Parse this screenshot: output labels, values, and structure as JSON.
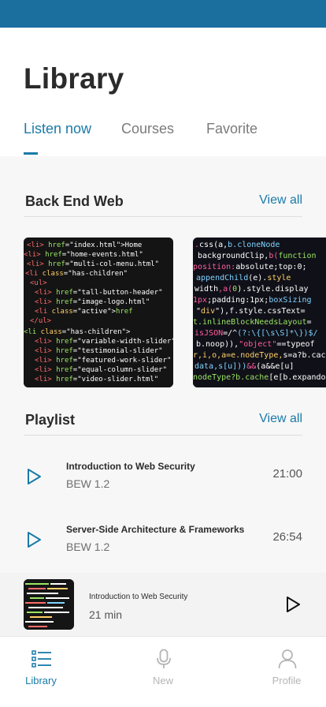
{
  "header": {
    "title": "Library",
    "tabs": [
      {
        "label": "Listen now",
        "active": true
      },
      {
        "label": "Courses",
        "active": false
      },
      {
        "label": "Favorite",
        "active": false
      }
    ]
  },
  "sections": {
    "backend": {
      "title": "Back End Web",
      "view_all": "View all"
    },
    "playlist": {
      "title": "Playlist",
      "view_all": "View all",
      "items": [
        {
          "title": "Introduction to Web Security",
          "subtitle": "BEW 1.2",
          "duration": "21:00"
        },
        {
          "title": "Server-Side Architecture & Frameworks",
          "subtitle": "BEW 1.2",
          "duration": "26:54"
        }
      ]
    }
  },
  "mini_player": {
    "title": "Introduction to Web Security",
    "subtitle": "21 min"
  },
  "tabbar": {
    "items": [
      {
        "label": "Library",
        "icon": "list-icon",
        "active": true
      },
      {
        "label": "New",
        "icon": "microphone-icon",
        "active": false
      },
      {
        "label": "Profile",
        "icon": "profile-icon",
        "active": false
      }
    ]
  },
  "colors": {
    "accent": "#1a7aa8",
    "status_bar": "#1a6f9e"
  }
}
